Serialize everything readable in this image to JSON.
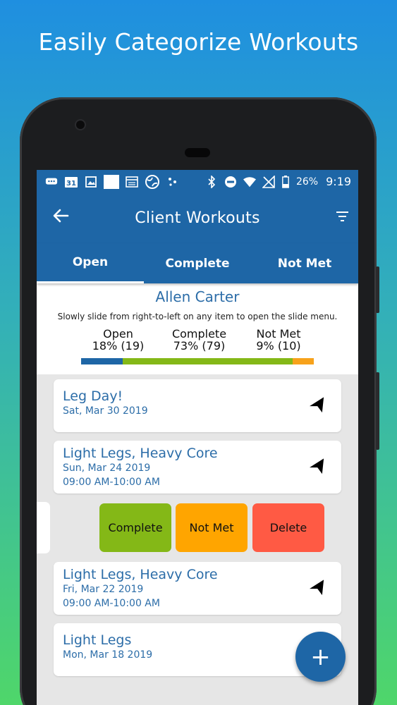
{
  "promo": {
    "headline": "Easily Categorize Workouts"
  },
  "status_bar": {
    "icons": [
      "message-icon",
      "calendar-icon",
      "image-icon",
      "square-icon",
      "calendar-grid-icon",
      "globe-icon",
      "dots-icon",
      "bluetooth-icon",
      "do-not-disturb-icon",
      "wifi-icon",
      "no-signal-icon",
      "battery-icon"
    ],
    "calendar_day": "31",
    "battery": "26%",
    "time": "9:19"
  },
  "app_bar": {
    "title": "Client Workouts",
    "back_icon": "back-arrow-icon",
    "filter_icon": "filter-icon"
  },
  "tabs": [
    {
      "label": "Open",
      "active": true
    },
    {
      "label": "Complete",
      "active": false
    },
    {
      "label": "Not Met",
      "active": false
    }
  ],
  "summary": {
    "client_name": "Allen Carter",
    "hint": "Slowly slide from right-to-left on any item to open the slide menu.",
    "stats": [
      {
        "label": "Open",
        "value": "18% (19)",
        "color": "#1e66a6",
        "fraction": 0.18
      },
      {
        "label": "Complete",
        "value": "73% (79)",
        "color": "#84b817",
        "fraction": 0.73
      },
      {
        "label": "Not Met",
        "value": "9% (10)",
        "color": "#f7a21b",
        "fraction": 0.09
      }
    ]
  },
  "workouts": [
    {
      "title": "Leg Day!",
      "date": "Sat, Mar 30 2019",
      "time": ""
    },
    {
      "title": "Light Legs, Heavy Core",
      "date": "Sun, Mar 24 2019",
      "time": "09:00 AM-10:00 AM"
    },
    {
      "title": "Light Legs, Heavy Core",
      "date": "Fri, Mar 22 2019",
      "time": "09:00 AM-10:00 AM"
    },
    {
      "title": "Light Legs",
      "date": "Mon, Mar 18 2019",
      "time": ""
    }
  ],
  "slide_menu": {
    "actions": [
      {
        "label": "Complete",
        "color": "#84b817"
      },
      {
        "label": "Not Met",
        "color": "#ffa500"
      },
      {
        "label": "Delete",
        "color": "#ff5a44"
      }
    ]
  },
  "fab": {
    "label": "+",
    "icon": "add-icon"
  }
}
